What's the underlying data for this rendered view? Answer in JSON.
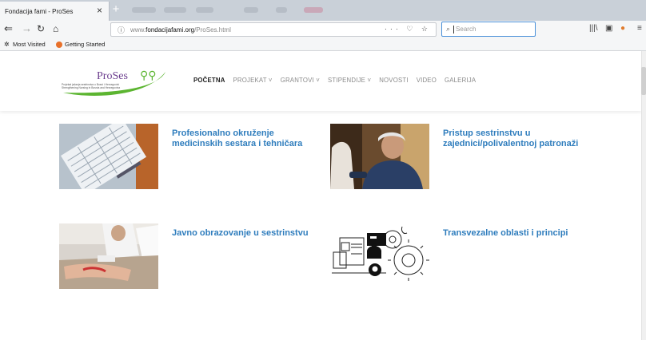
{
  "browser": {
    "tab_title": "Fondacija fami - ProSes",
    "tab_close": "×",
    "new_tab": "+",
    "url_prefix": "www.",
    "url_domain": "fondacijafami.org",
    "url_path": "/ProSes.html",
    "url_actions": "··· ♡ ☆",
    "search_placeholder": "Search",
    "bookmarks": [
      {
        "label": "Most Visited"
      },
      {
        "label": "Getting Started"
      }
    ]
  },
  "site": {
    "logo": {
      "name": "ProSes",
      "tagline_1": "Projekat jačanja sestrinstva u Bosni i Hercegovini",
      "tagline_2": "Strengthening Nursing in Bosnia and Herzegovina"
    },
    "menu": [
      {
        "label": "POČETNA",
        "active": true
      },
      {
        "label": "PROJEKAT ˅",
        "active": false
      },
      {
        "label": "GRANTOVI ˅",
        "active": false
      },
      {
        "label": "STIPENDIJE ˅",
        "active": false
      },
      {
        "label": "NOVOSTI",
        "active": false
      },
      {
        "label": "VIDEO",
        "active": false
      },
      {
        "label": "GALERIJA",
        "active": false
      }
    ],
    "cards": [
      {
        "title": "Profesionalno okruženje medicinskih sestara i tehničara"
      },
      {
        "title": "Pristup sestrinstvu u zajednici/polivalentnoj patronaži"
      },
      {
        "title": "Javno obrazovanje u sestrinstvu"
      },
      {
        "title": "Transvezalne oblasti i principi"
      }
    ]
  },
  "colors": {
    "accent_blue": "#2f7dbd",
    "logo_green": "#5cb531",
    "logo_purple": "#6b3d8e"
  }
}
